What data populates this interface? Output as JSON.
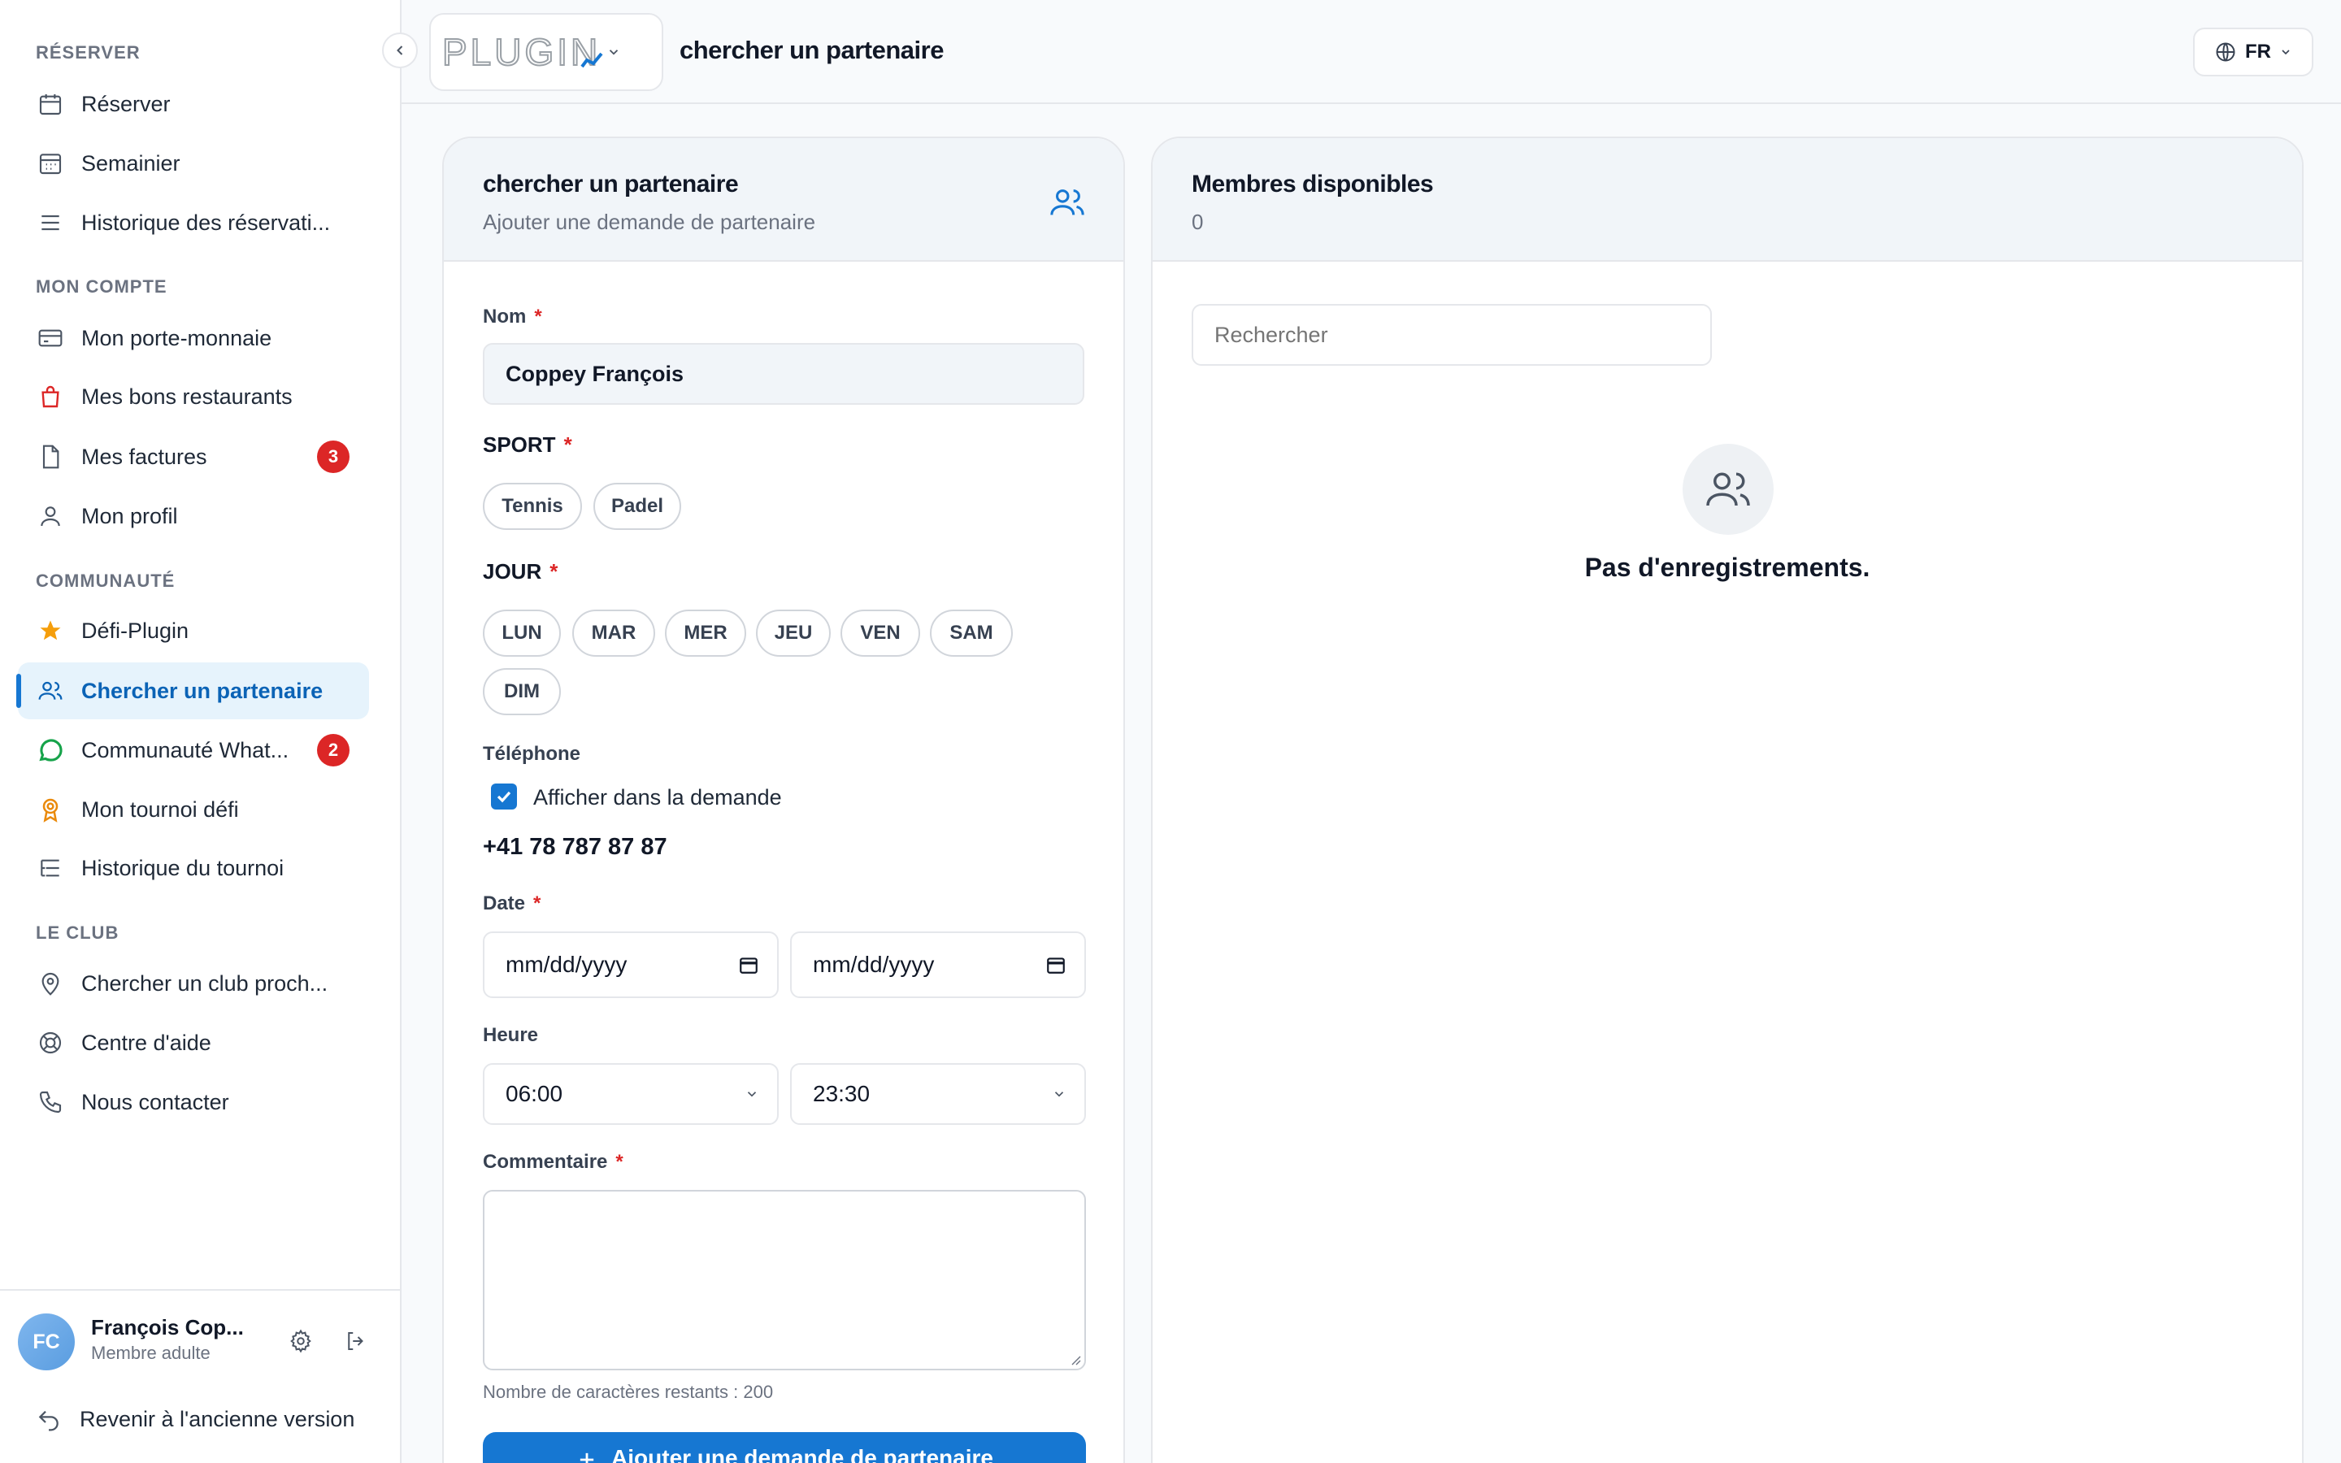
{
  "sidebar": {
    "sections": [
      "RÉSERVER",
      "MON COMPTE",
      "COMMUNAUTÉ",
      "LE CLUB"
    ],
    "items": [
      {
        "label": "Réserver"
      },
      {
        "label": "Semainier"
      },
      {
        "label": "Historique des réservati..."
      },
      {
        "label": "Mon porte-monnaie"
      },
      {
        "label": "Mes bons restaurants"
      },
      {
        "label": "Mes factures",
        "badge": "3"
      },
      {
        "label": "Mon profil"
      },
      {
        "label": "Défi-Plugin"
      },
      {
        "label": "Chercher un partenaire"
      },
      {
        "label": "Communauté What...",
        "badge": "2"
      },
      {
        "label": "Mon tournoi défi"
      },
      {
        "label": "Historique du tournoi"
      },
      {
        "label": "Chercher un club proch..."
      },
      {
        "label": "Centre d'aide"
      },
      {
        "label": "Nous contacter"
      }
    ],
    "user": {
      "initials": "FC",
      "name": "François Cop...",
      "role": "Membre adulte"
    },
    "old_version": "Revenir à l'ancienne version"
  },
  "header": {
    "logo_text": "PLUGIN",
    "title": "chercher un partenaire",
    "lang": "FR"
  },
  "form_card": {
    "title": "chercher un partenaire",
    "subtitle": "Ajouter une demande de partenaire",
    "name_label": "Nom",
    "name_value": "Coppey François",
    "sport_label": "SPORT",
    "sports": [
      "Tennis",
      "Padel"
    ],
    "day_label": "JOUR",
    "days": [
      "LUN",
      "MAR",
      "MER",
      "JEU",
      "VEN",
      "SAM",
      "DIM"
    ],
    "phone_label": "Téléphone",
    "phone_checkbox_label": "Afficher dans la demande",
    "phone_checked": true,
    "phone_value": "+41 78 787 87 87",
    "date_label": "Date",
    "date_from": "mm/dd/yyyy",
    "date_to": "mm/dd/yyyy",
    "time_label": "Heure",
    "time_from": "06:00",
    "time_to": "23:30",
    "comment_label": "Commentaire",
    "chars_remaining": "Nombre de caractères restants : 200",
    "submit_label": "Ajouter une demande de partenaire",
    "required_mark": "*"
  },
  "members_card": {
    "title": "Membres disponibles",
    "count": "0",
    "search_placeholder": "Rechercher",
    "empty_text": "Pas d'enregistrements."
  },
  "colors": {
    "primary": "#1677d2",
    "badge": "#dc2626",
    "active_bg": "#e6f3fc"
  }
}
